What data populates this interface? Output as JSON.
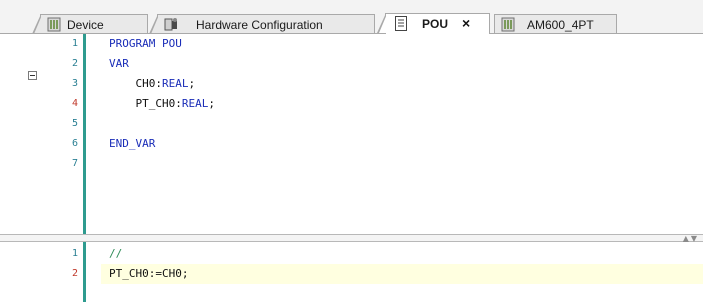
{
  "tabs": [
    {
      "label": "Device",
      "icon": "device-icon",
      "active": false
    },
    {
      "label": "Hardware Configuration",
      "icon": "hardware-config-icon",
      "active": false
    },
    {
      "label": "POU",
      "icon": "pou-document-icon",
      "active": true,
      "close": "×"
    },
    {
      "label": "AM600_4PT",
      "icon": "device-icon",
      "active": false
    }
  ],
  "declaration": {
    "lines": [
      {
        "num": "1",
        "parts": [
          {
            "t": "PROGRAM POU",
            "c": "kw"
          }
        ]
      },
      {
        "num": "2",
        "parts": [
          {
            "t": "VAR",
            "c": "kw"
          }
        ]
      },
      {
        "num": "3",
        "parts": [
          {
            "t": "    CH0:",
            "c": ""
          },
          {
            "t": "REAL",
            "c": "ty"
          },
          {
            "t": ";",
            "c": ""
          }
        ]
      },
      {
        "num": "4",
        "parts": [
          {
            "t": "    PT_CH0:",
            "c": ""
          },
          {
            "t": "REAL",
            "c": "ty"
          },
          {
            "t": ";",
            "c": ""
          }
        ]
      },
      {
        "num": "5",
        "parts": []
      },
      {
        "num": "6",
        "parts": [
          {
            "t": "END_VAR",
            "c": "kw"
          }
        ]
      },
      {
        "num": "7",
        "parts": []
      }
    ]
  },
  "implementation": {
    "lines": [
      {
        "num": "1",
        "parts": [
          {
            "t": "//",
            "c": "cm"
          }
        ]
      },
      {
        "num": "2",
        "parts": [
          {
            "t": "PT_CH0:=CH0;",
            "c": ""
          }
        ]
      }
    ]
  },
  "colors": {
    "keyword": "#1a2db8",
    "comment": "#2e8b57",
    "line_number": "#2a7f93",
    "modified_line_number": "#c0392b",
    "current_line_highlight": "#ffffe0",
    "change_bar": "#2e9b8f"
  }
}
